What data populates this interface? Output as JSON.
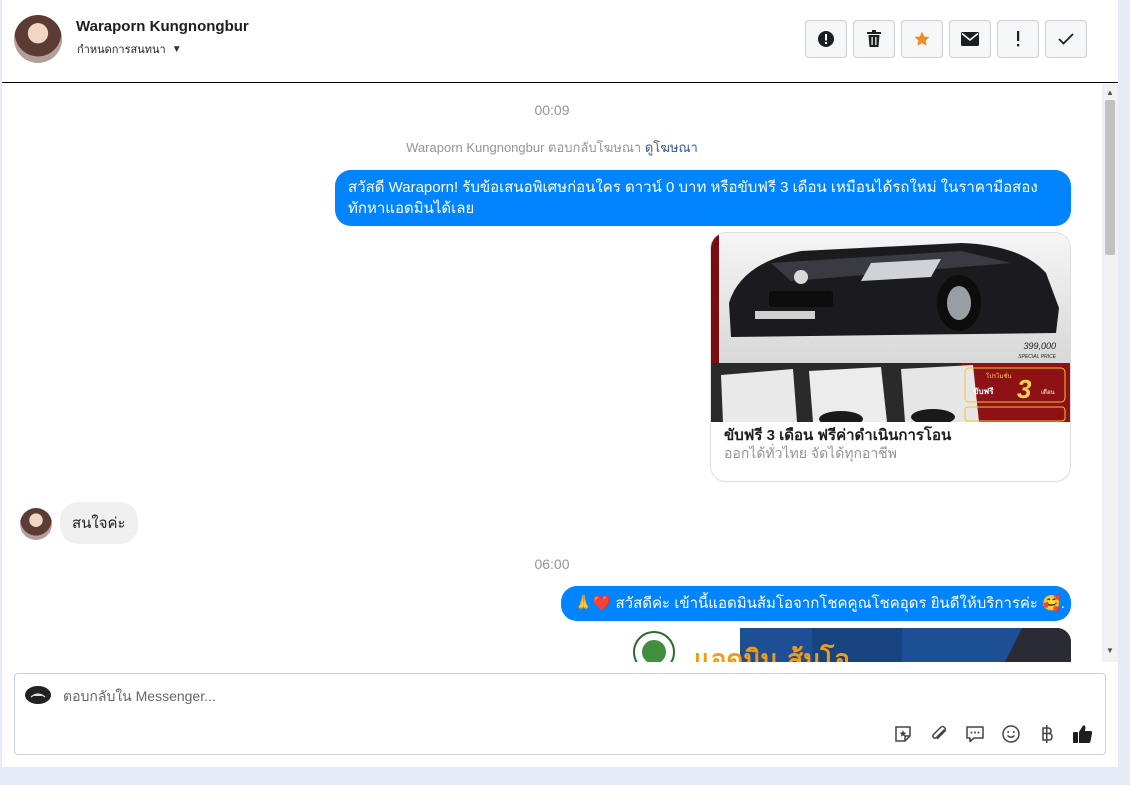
{
  "header": {
    "contact_name": "Waraporn Kungnongbur",
    "assign_label": "กำหนดการสนทนา",
    "toolbar": {
      "icons": [
        "alert-circle-icon",
        "trash-icon",
        "star-icon",
        "mail-icon",
        "exclamation-icon",
        "check-icon"
      ],
      "star_color": "#f28b1e"
    }
  },
  "conversation": {
    "time_1": "00:09",
    "reply_note_prefix": "Waraporn Kungnongbur ตอบกลับโฆษณา",
    "reply_note_link": "ดูโฆษณา",
    "message_out_1_line1": "สวัสดี Waraporn! รับข้อเสนอพิเศษก่อนใคร ดาวน์ 0 บาท หรือขับฟรี 3 เดือน เหมือนได้รถใหม่ ในราคามือสอง",
    "message_out_1_line2": "ทักหาแอดมินได้เลย",
    "ad": {
      "title": "ขับฟรี 3 เดือน ฟรีค่าดำเนินการโอน",
      "subtitle": "ออกได้ทั่วไทย จัดได้ทุกอาชีพ",
      "price": "399,000",
      "price_caption": "SPECIAL PRICE",
      "promo_number": "3",
      "promo_top": "โปรโมชั่น",
      "promo_prefix": "ขับฟรี",
      "promo_unit": "เดือน",
      "brand_color": "#0084ff",
      "promo_bg": "#8e1116"
    },
    "message_in_1": "สนใจค่ะ",
    "time_2": "06:00",
    "message_out_2": "🙏❤️ สวัสดีค่ะ เข้านี้แอดมินส้มโอจากโชคคูณโชคอุดร ยินดีให้บริการค่ะ 🥰.",
    "preview_text": "แอดมิน ส้มโอ"
  },
  "composer": {
    "placeholder": "ตอบกลับใน Messenger...",
    "icons": [
      "sticker-icon",
      "attachment-icon",
      "saved-reply-icon",
      "emoji-icon",
      "baht-icon",
      "thumbs-up-icon"
    ]
  }
}
